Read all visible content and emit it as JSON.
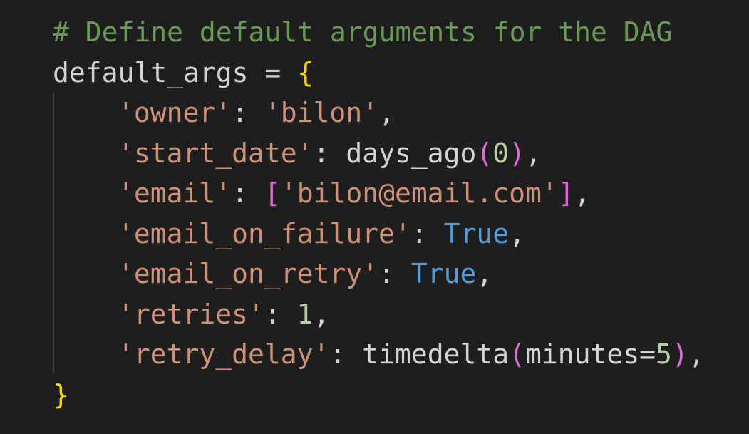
{
  "code": {
    "comment": "# Define default arguments for the DAG",
    "var_name": "default_args",
    "assign_op": " = ",
    "open_brace": "{",
    "close_brace": "}",
    "colon": ": ",
    "comma": ",",
    "entries": {
      "owner": {
        "key": "'owner'",
        "value": "'bilon'"
      },
      "start_date": {
        "key": "'start_date'",
        "func": "days_ago",
        "open_paren": "(",
        "arg": "0",
        "close_paren": ")"
      },
      "email": {
        "key": "'email'",
        "open_bracket": "[",
        "value": "'bilon@email.com'",
        "close_bracket": "]"
      },
      "email_on_failure": {
        "key": "'email_on_failure'",
        "value": "True"
      },
      "email_on_retry": {
        "key": "'email_on_retry'",
        "value": "True"
      },
      "retries": {
        "key": "'retries'",
        "value": "1"
      },
      "retry_delay": {
        "key": "'retry_delay'",
        "func": "timedelta",
        "open_paren": "(",
        "param": "minutes",
        "equals": "=",
        "arg": "5",
        "close_paren": ")"
      }
    }
  },
  "colors": {
    "background": "#1e1e1e",
    "comment": "#6a9955",
    "string": "#ce9178",
    "keyword_constant": "#569cd6",
    "number": "#b5cea8",
    "brace": "#ffd700",
    "paren": "#da70d6",
    "text": "#d4d4d4"
  }
}
